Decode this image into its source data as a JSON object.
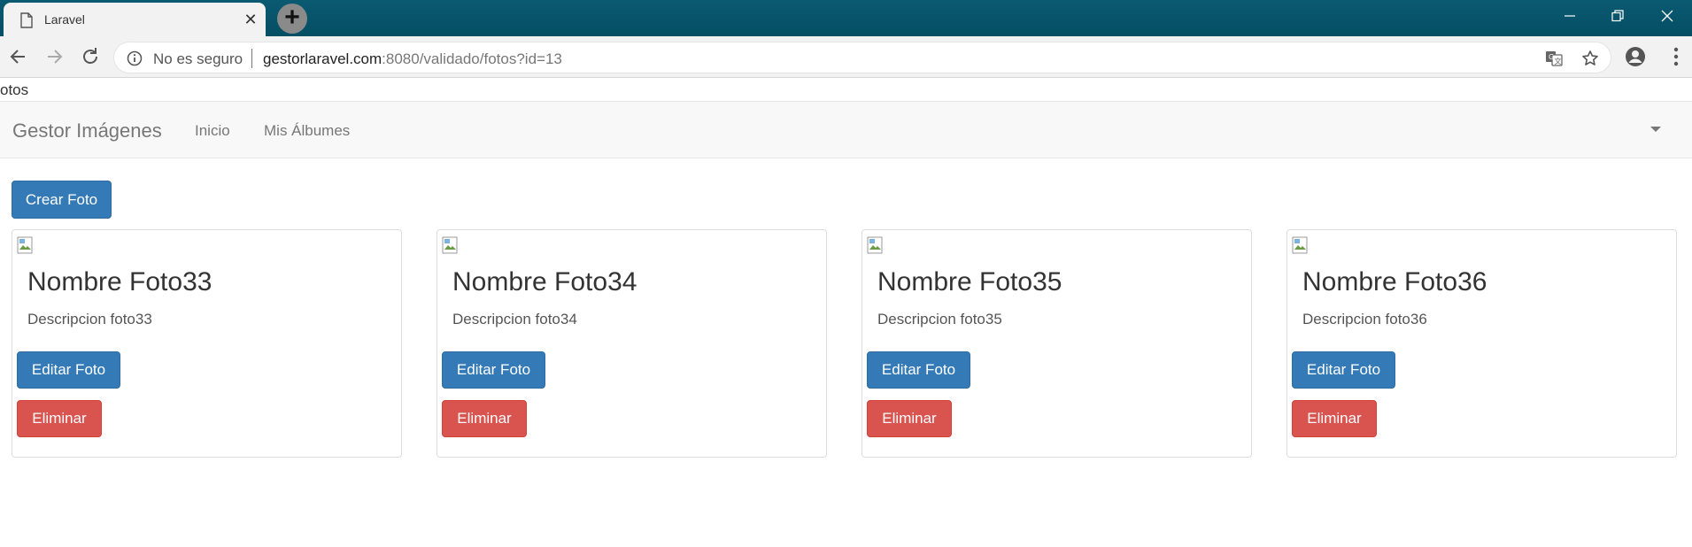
{
  "browser": {
    "tab_title": "Laravel",
    "security_label": "No es seguro",
    "url_host": "gestorlaravel.com",
    "url_rest": ":8080/validado/fotos?id=13"
  },
  "page": {
    "title_stub": "otos"
  },
  "navbar": {
    "brand": "Gestor Imágenes",
    "links": [
      {
        "label": "Inicio"
      },
      {
        "label": "Mis Álbumes"
      }
    ]
  },
  "main": {
    "create_label": "Crear Foto",
    "cards": [
      {
        "title": "Nombre Foto33",
        "description": "Descripcion foto33",
        "edit_label": "Editar Foto",
        "delete_label": "Eliminar"
      },
      {
        "title": "Nombre Foto34",
        "description": "Descripcion foto34",
        "edit_label": "Editar Foto",
        "delete_label": "Eliminar"
      },
      {
        "title": "Nombre Foto35",
        "description": "Descripcion foto35",
        "edit_label": "Editar Foto",
        "delete_label": "Eliminar"
      },
      {
        "title": "Nombre Foto36",
        "description": "Descripcion foto36",
        "edit_label": "Editar Foto",
        "delete_label": "Eliminar"
      }
    ]
  },
  "colors": {
    "primary": "#337ab7",
    "danger": "#d9534f",
    "titlebar": "#054e63"
  }
}
